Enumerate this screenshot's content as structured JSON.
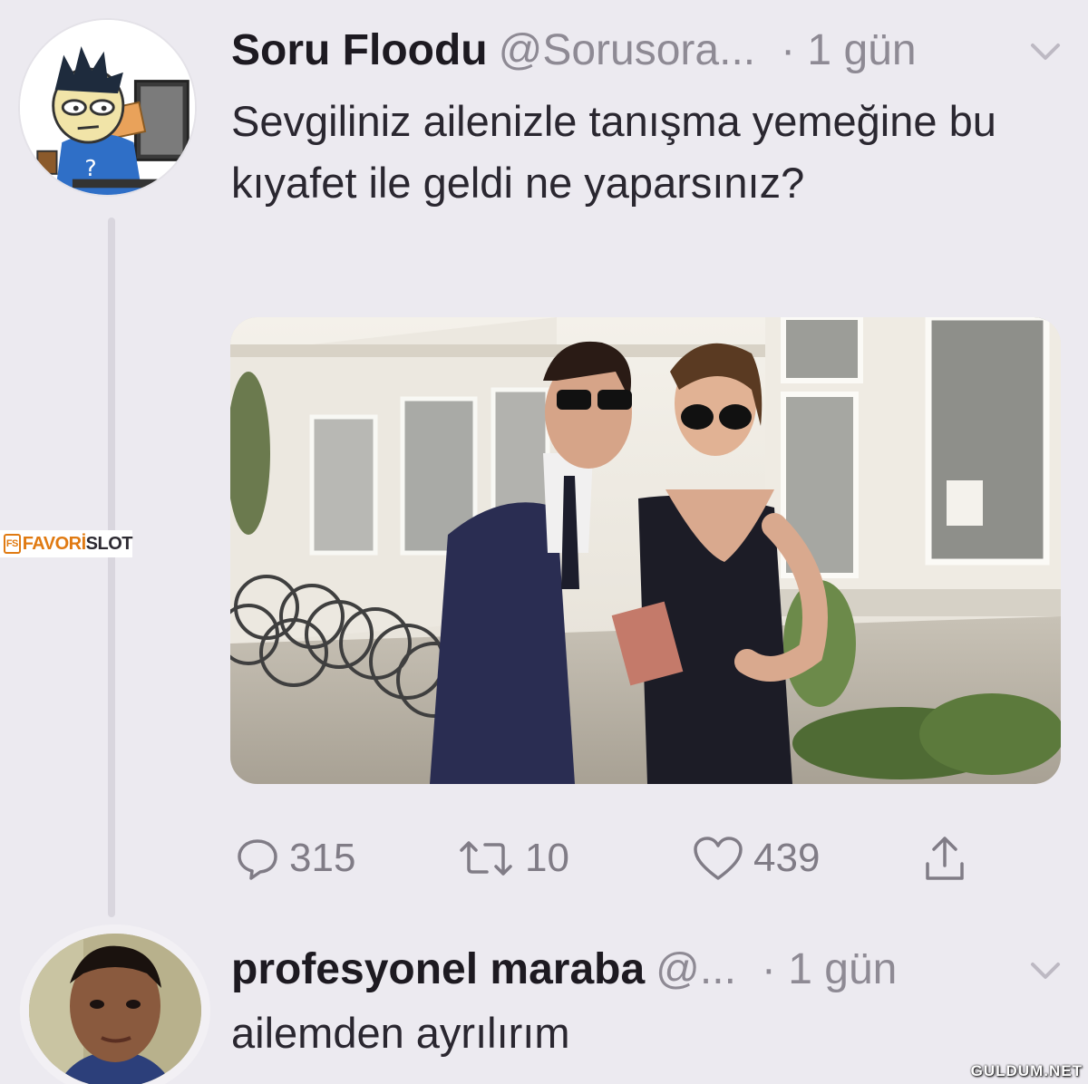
{
  "tweet": {
    "author_name": "Soru Floodu",
    "author_handle": "@Sorusora...",
    "time": "· 1 gün",
    "text": "Sevgiliniz ailenizle tanışma yemeğine bu kıyafet ile geldi ne yaparsınız?",
    "reply_count": "315",
    "retweet_count": "10",
    "like_count": "439"
  },
  "reply": {
    "author_name": "profesyonel maraba",
    "author_handle": "@...",
    "time": "· 1 gün",
    "text": "ailemden ayrılırım"
  },
  "watermarks": {
    "left_icon": "FS",
    "left_word1": "FAVORİ",
    "left_word2": "SLOT",
    "right": "GULDUM.NET"
  },
  "icons": {
    "reply": "speech-bubble-icon",
    "retweet": "retweet-arrows-icon",
    "like": "heart-icon",
    "share": "share-upload-icon",
    "more": "chevron-down-icon"
  },
  "colors": {
    "background": "#eceaf0",
    "muted": "#8e8a94",
    "text": "#2a2730"
  }
}
